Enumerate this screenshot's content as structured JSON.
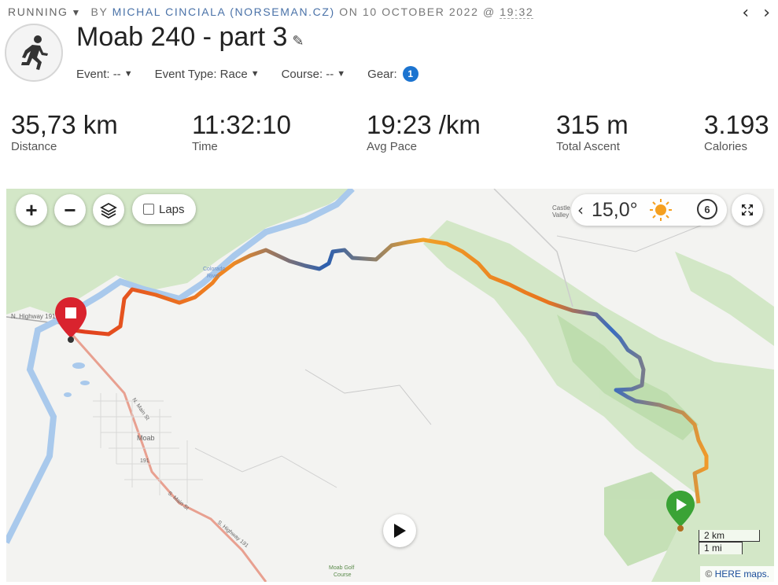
{
  "meta": {
    "activity_type": "RUNNING",
    "by_prefix": "BY",
    "author": "MICHAL CINCIALA (NORSEMAN.CZ)",
    "on_prefix": "ON",
    "date": "10 OCTOBER 2022",
    "at": "@",
    "time": "19:32"
  },
  "nav": {
    "prev": "‹",
    "next": "›"
  },
  "title": "Moab 240 - part 3",
  "fields": {
    "event": "Event: --",
    "event_type": "Event Type: Race",
    "course": "Course: --",
    "gear": "Gear:",
    "gear_count": "1"
  },
  "stats": [
    {
      "value": "35,73 km",
      "label": "Distance"
    },
    {
      "value": "11:32:10",
      "label": "Time"
    },
    {
      "value": "19:23 /km",
      "label": "Avg Pace"
    },
    {
      "value": "315 m",
      "label": "Total Ascent"
    },
    {
      "value": "3.193",
      "label": "Calories"
    }
  ],
  "map": {
    "zoom_in": "+",
    "zoom_out": "−",
    "laps_label": "Laps",
    "temperature": "15,0°",
    "wind": "6",
    "scale_km": "2 km",
    "scale_mi": "1 mi",
    "attribution_prefix": "©",
    "attribution": "HERE maps.",
    "labels": {
      "castle_valley_1": "Castle",
      "castle_valley_2": "Valley",
      "highway_191": "N. Highway 191",
      "main_st_n": "N. Main St",
      "main_st_s": "S. Main St",
      "highway_s": "S. Highway 191",
      "moab": "Moab",
      "route": "191",
      "colorado": "Colorado",
      "river": "River",
      "golf_1": "Moab Golf",
      "golf_2": "Course"
    }
  }
}
